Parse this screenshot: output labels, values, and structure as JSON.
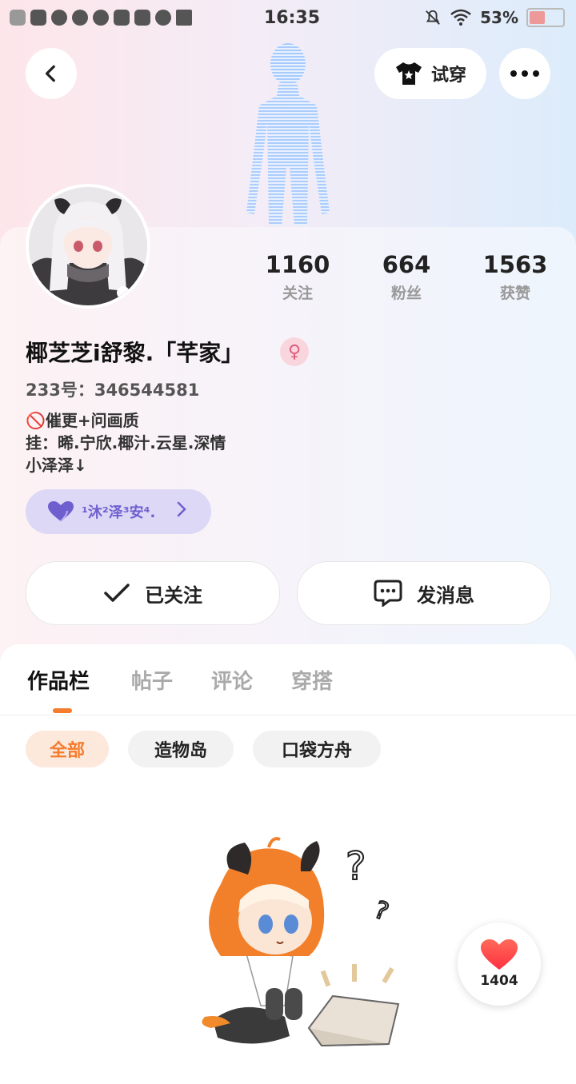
{
  "status_bar": {
    "time": "16:35",
    "battery": "53%",
    "battery_level": 0.53,
    "icons": [
      "notification-app-icons",
      "mute-bell-icon",
      "wifi-icon",
      "battery-icon"
    ]
  },
  "header": {
    "back_icon": "chevron-left-icon",
    "try_on_label": "试穿",
    "more_icon": "more-dots-icon"
  },
  "profile": {
    "stats": [
      {
        "value": "1160",
        "label": "关注"
      },
      {
        "value": "664",
        "label": "粉丝"
      },
      {
        "value": "1563",
        "label": "获赞"
      }
    ],
    "nickname": "椰芝芝i舒黎.「芊家」",
    "gender_symbol": "♀",
    "uid": "233号：346544581",
    "bio_lines": [
      "🚫催更+问画质",
      "挂：晞.宁欣.椰汁.云星.深情",
      "小泽泽↓"
    ],
    "cp_chip": {
      "text": "¹沐²泽³安⁴.",
      "icon": "heart-icon"
    }
  },
  "actions": {
    "follow_label": "已关注",
    "message_label": "发消息"
  },
  "tabs": [
    "作品栏",
    "帖子",
    "评论",
    "穿搭"
  ],
  "filters": [
    "全部",
    "造物岛",
    "口袋方舟"
  ],
  "floating_like": {
    "count": "1404"
  },
  "colors": {
    "accent": "#f47c2c",
    "cp_purple": "#6e5fcf",
    "heart_red": "#ff4d4d"
  }
}
